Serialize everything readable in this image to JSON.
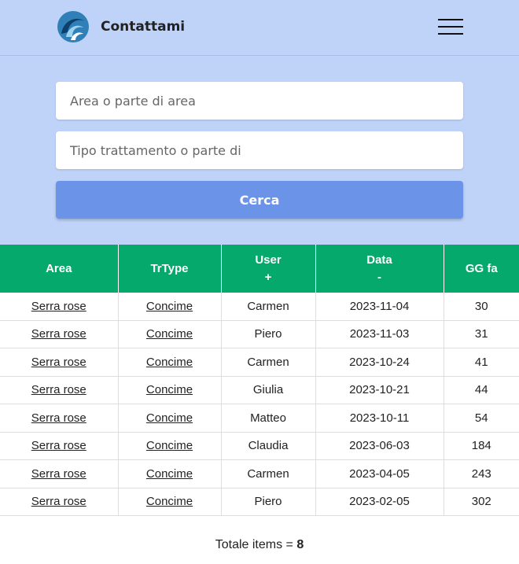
{
  "header": {
    "title": "Contattami"
  },
  "search": {
    "area_placeholder": "Area o parte di area",
    "type_placeholder": "Tipo trattamento o parte di",
    "button_label": "Cerca"
  },
  "table": {
    "columns": [
      {
        "label": "Area",
        "sort": ""
      },
      {
        "label": "TrType",
        "sort": ""
      },
      {
        "label": "User",
        "sort": "+"
      },
      {
        "label": "Data",
        "sort": "-"
      },
      {
        "label": "GG fa",
        "sort": ""
      }
    ],
    "rows": [
      {
        "area": "Serra rose",
        "type": "Concime",
        "user": "Carmen",
        "date": "2023-11-04",
        "days": "30"
      },
      {
        "area": "Serra rose",
        "type": "Concime",
        "user": "Piero",
        "date": "2023-11-03",
        "days": "31"
      },
      {
        "area": "Serra rose",
        "type": "Concime",
        "user": "Carmen",
        "date": "2023-10-24",
        "days": "41"
      },
      {
        "area": "Serra rose",
        "type": "Concime",
        "user": "Giulia",
        "date": "2023-10-21",
        "days": "44"
      },
      {
        "area": "Serra rose",
        "type": "Concime",
        "user": "Matteo",
        "date": "2023-10-11",
        "days": "54"
      },
      {
        "area": "Serra rose",
        "type": "Concime",
        "user": "Claudia",
        "date": "2023-06-03",
        "days": "184"
      },
      {
        "area": "Serra rose",
        "type": "Concime",
        "user": "Carmen",
        "date": "2023-04-05",
        "days": "243"
      },
      {
        "area": "Serra rose",
        "type": "Concime",
        "user": "Piero",
        "date": "2023-02-05",
        "days": "302"
      }
    ]
  },
  "footer": {
    "total_label": "Totale items =",
    "total_count": "8"
  },
  "colors": {
    "panel": "#bfd2f8",
    "button": "#6b94e8",
    "table_header": "#05a96b"
  },
  "icons": {
    "logo": "wave-logo-icon",
    "menu": "hamburger-menu-icon"
  }
}
